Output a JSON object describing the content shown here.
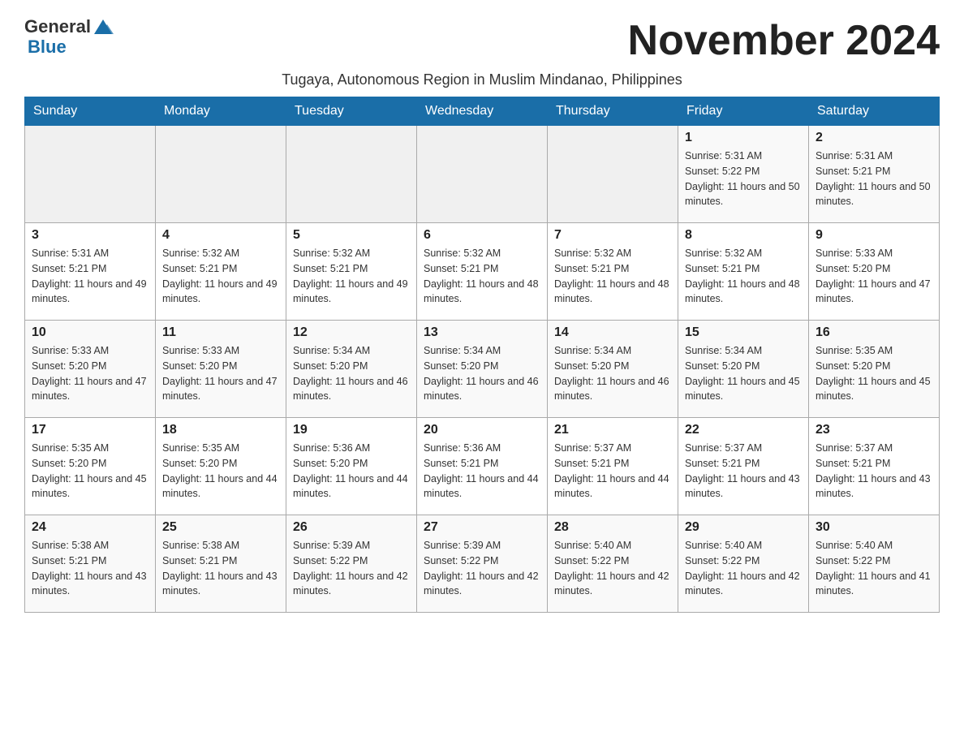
{
  "logo": {
    "text_general": "General",
    "text_blue": "Blue"
  },
  "title": "November 2024",
  "subtitle": "Tugaya, Autonomous Region in Muslim Mindanao, Philippines",
  "weekdays": [
    "Sunday",
    "Monday",
    "Tuesday",
    "Wednesday",
    "Thursday",
    "Friday",
    "Saturday"
  ],
  "weeks": [
    [
      {
        "day": "",
        "info": ""
      },
      {
        "day": "",
        "info": ""
      },
      {
        "day": "",
        "info": ""
      },
      {
        "day": "",
        "info": ""
      },
      {
        "day": "",
        "info": ""
      },
      {
        "day": "1",
        "info": "Sunrise: 5:31 AM\nSunset: 5:22 PM\nDaylight: 11 hours and 50 minutes."
      },
      {
        "day": "2",
        "info": "Sunrise: 5:31 AM\nSunset: 5:21 PM\nDaylight: 11 hours and 50 minutes."
      }
    ],
    [
      {
        "day": "3",
        "info": "Sunrise: 5:31 AM\nSunset: 5:21 PM\nDaylight: 11 hours and 49 minutes."
      },
      {
        "day": "4",
        "info": "Sunrise: 5:32 AM\nSunset: 5:21 PM\nDaylight: 11 hours and 49 minutes."
      },
      {
        "day": "5",
        "info": "Sunrise: 5:32 AM\nSunset: 5:21 PM\nDaylight: 11 hours and 49 minutes."
      },
      {
        "day": "6",
        "info": "Sunrise: 5:32 AM\nSunset: 5:21 PM\nDaylight: 11 hours and 48 minutes."
      },
      {
        "day": "7",
        "info": "Sunrise: 5:32 AM\nSunset: 5:21 PM\nDaylight: 11 hours and 48 minutes."
      },
      {
        "day": "8",
        "info": "Sunrise: 5:32 AM\nSunset: 5:21 PM\nDaylight: 11 hours and 48 minutes."
      },
      {
        "day": "9",
        "info": "Sunrise: 5:33 AM\nSunset: 5:20 PM\nDaylight: 11 hours and 47 minutes."
      }
    ],
    [
      {
        "day": "10",
        "info": "Sunrise: 5:33 AM\nSunset: 5:20 PM\nDaylight: 11 hours and 47 minutes."
      },
      {
        "day": "11",
        "info": "Sunrise: 5:33 AM\nSunset: 5:20 PM\nDaylight: 11 hours and 47 minutes."
      },
      {
        "day": "12",
        "info": "Sunrise: 5:34 AM\nSunset: 5:20 PM\nDaylight: 11 hours and 46 minutes."
      },
      {
        "day": "13",
        "info": "Sunrise: 5:34 AM\nSunset: 5:20 PM\nDaylight: 11 hours and 46 minutes."
      },
      {
        "day": "14",
        "info": "Sunrise: 5:34 AM\nSunset: 5:20 PM\nDaylight: 11 hours and 46 minutes."
      },
      {
        "day": "15",
        "info": "Sunrise: 5:34 AM\nSunset: 5:20 PM\nDaylight: 11 hours and 45 minutes."
      },
      {
        "day": "16",
        "info": "Sunrise: 5:35 AM\nSunset: 5:20 PM\nDaylight: 11 hours and 45 minutes."
      }
    ],
    [
      {
        "day": "17",
        "info": "Sunrise: 5:35 AM\nSunset: 5:20 PM\nDaylight: 11 hours and 45 minutes."
      },
      {
        "day": "18",
        "info": "Sunrise: 5:35 AM\nSunset: 5:20 PM\nDaylight: 11 hours and 44 minutes."
      },
      {
        "day": "19",
        "info": "Sunrise: 5:36 AM\nSunset: 5:20 PM\nDaylight: 11 hours and 44 minutes."
      },
      {
        "day": "20",
        "info": "Sunrise: 5:36 AM\nSunset: 5:21 PM\nDaylight: 11 hours and 44 minutes."
      },
      {
        "day": "21",
        "info": "Sunrise: 5:37 AM\nSunset: 5:21 PM\nDaylight: 11 hours and 44 minutes."
      },
      {
        "day": "22",
        "info": "Sunrise: 5:37 AM\nSunset: 5:21 PM\nDaylight: 11 hours and 43 minutes."
      },
      {
        "day": "23",
        "info": "Sunrise: 5:37 AM\nSunset: 5:21 PM\nDaylight: 11 hours and 43 minutes."
      }
    ],
    [
      {
        "day": "24",
        "info": "Sunrise: 5:38 AM\nSunset: 5:21 PM\nDaylight: 11 hours and 43 minutes."
      },
      {
        "day": "25",
        "info": "Sunrise: 5:38 AM\nSunset: 5:21 PM\nDaylight: 11 hours and 43 minutes."
      },
      {
        "day": "26",
        "info": "Sunrise: 5:39 AM\nSunset: 5:22 PM\nDaylight: 11 hours and 42 minutes."
      },
      {
        "day": "27",
        "info": "Sunrise: 5:39 AM\nSunset: 5:22 PM\nDaylight: 11 hours and 42 minutes."
      },
      {
        "day": "28",
        "info": "Sunrise: 5:40 AM\nSunset: 5:22 PM\nDaylight: 11 hours and 42 minutes."
      },
      {
        "day": "29",
        "info": "Sunrise: 5:40 AM\nSunset: 5:22 PM\nDaylight: 11 hours and 42 minutes."
      },
      {
        "day": "30",
        "info": "Sunrise: 5:40 AM\nSunset: 5:22 PM\nDaylight: 11 hours and 41 minutes."
      }
    ]
  ]
}
